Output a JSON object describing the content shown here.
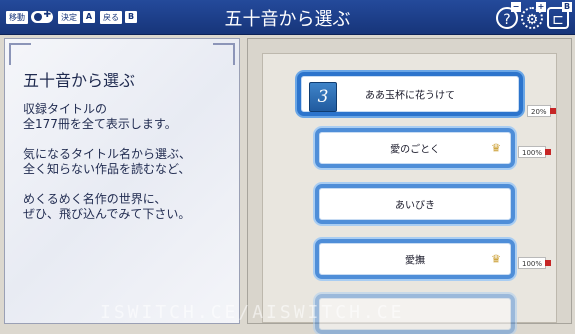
{
  "topbar": {
    "move_label": "移動",
    "decide_label": "決定",
    "decide_key": "A",
    "back_label": "戻る",
    "back_key": "B",
    "title": "五十音から選ぶ",
    "help_icon": "help-icon",
    "settings_icon": "gear-icon",
    "settings_badge": "+",
    "exit_icon": "exit-icon",
    "exit_badge": "B",
    "help_badge": "−"
  },
  "info_panel": {
    "title": "五十音から選ぶ",
    "body": "収録タイトルの\n全177冊を全て表示します。\n\n気になるタイトル名から選ぶ、\n全く知らない作品を読むなど、\n\nめくるめく名作の世界に、\nぜひ、飛び込んでみて下さい。"
  },
  "list": {
    "items": [
      {
        "title": "ああ玉杯に花うけて",
        "progress": "20%",
        "book_number": "3",
        "crown": false
      },
      {
        "title": "愛のごとく",
        "progress": "100%",
        "crown": true
      },
      {
        "title": "あいびき",
        "progress": "",
        "crown": false
      },
      {
        "title": "愛撫",
        "progress": "100%",
        "crown": true
      }
    ],
    "crown_glyph": "♛"
  },
  "watermark": "ISWITCH.CE/AISWITCH.CE",
  "colors": {
    "topbar": "#1f4594",
    "item_border": "#4f8ed8",
    "accent_flag": "#c62626"
  }
}
